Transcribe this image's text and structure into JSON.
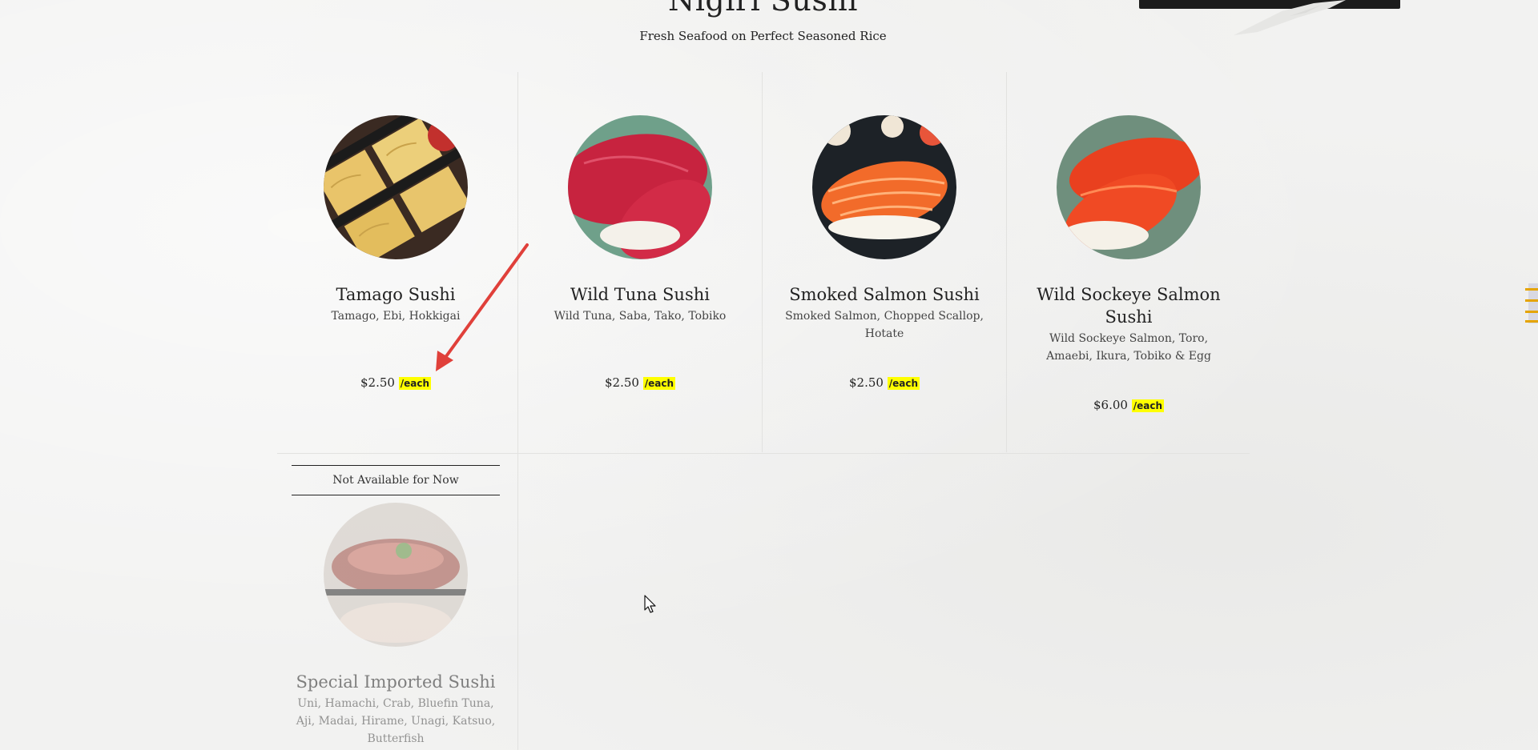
{
  "header": {
    "title": "Nigiri Sushi",
    "subtitle": "Fresh Seafood on Perfect Seasoned Rice"
  },
  "menu": {
    "items": [
      {
        "name": "Tamago Sushi",
        "desc": "Tamago, Ebi, Hokkigai",
        "price": "$2.50",
        "unit": "/each"
      },
      {
        "name": "Wild Tuna Sushi",
        "desc": "Wild Tuna, Saba, Tako, Tobiko",
        "price": "$2.50",
        "unit": "/each"
      },
      {
        "name": "Smoked Salmon Sushi",
        "desc": "Smoked Salmon, Chopped Scallop, Hotate",
        "price": "$2.50",
        "unit": "/each"
      },
      {
        "name": "Wild Sockeye Salmon Sushi",
        "desc": "Wild Sockeye Salmon, Toro, Amaebi, Ikura, Tobiko & Egg",
        "price": "$6.00",
        "unit": "/each"
      }
    ],
    "unavailable": {
      "banner": "Not Available for Now",
      "name": "Special Imported Sushi",
      "desc": "Uni, Hamachi, Crab, Bluefin Tuna, Aji, Madai, Hirame, Unagi, Katsuo, Butterfish"
    }
  },
  "colors": {
    "price_tag_bg": "#ffff00",
    "annotation_arrow": "#e0403a"
  },
  "icons": [
    "annotation-arrow-icon",
    "mouse-cursor-icon",
    "scroll-indicator-icon"
  ]
}
